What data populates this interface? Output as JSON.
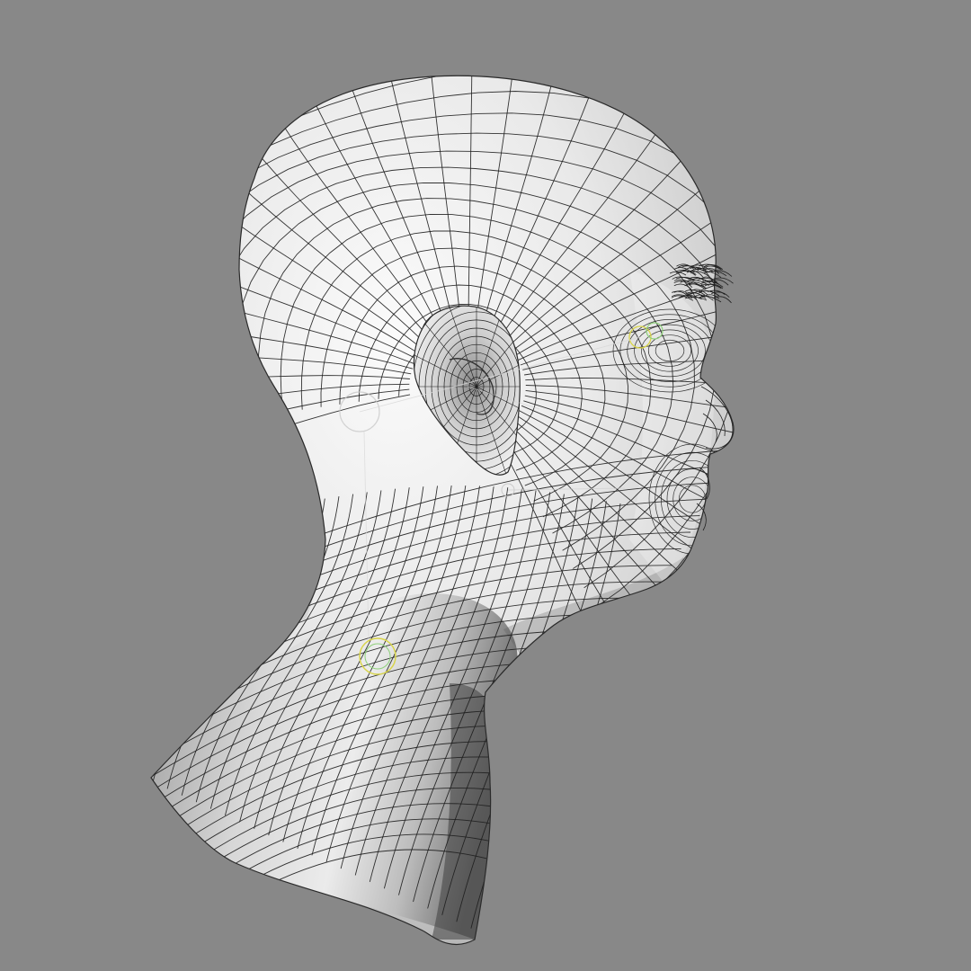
{
  "scene": {
    "subject": "head-neck-wireframe-mesh",
    "view": "side-profile",
    "colors": {
      "background": "#888888",
      "surface_light": "#f2f2f2",
      "surface_mid": "#d6d6d6",
      "surface_dark": "#7e7e7e",
      "wire": "#1e1e1e",
      "rig_helper_yellow": "#d8d44a",
      "rig_helper_green": "#8ed07a",
      "rig_helper_gray": "#c9c9c9"
    },
    "icons": [
      "rig-control-circle",
      "rig-control-line"
    ]
  }
}
